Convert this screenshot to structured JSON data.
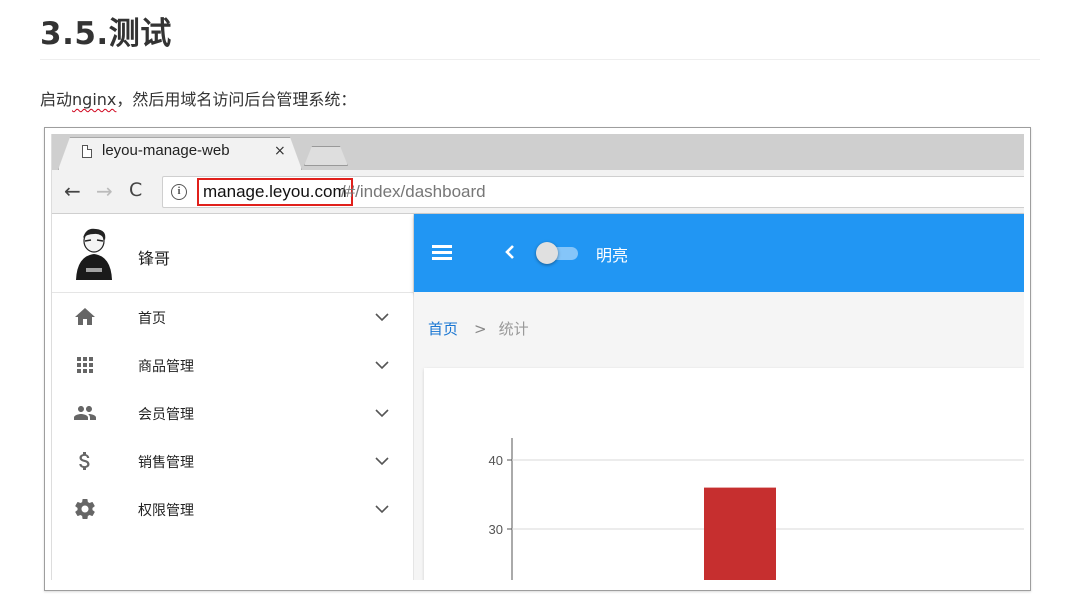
{
  "doc": {
    "heading": "3.5.测试",
    "para_before": "启动",
    "para_squiggle": "nginx",
    "para_after": "，然后用域名访问后台管理系统："
  },
  "browser": {
    "tab_title": "leyou-manage-web",
    "tab_close": "×",
    "back_glyph": "←",
    "forward_glyph": "→",
    "reload_glyph": "C",
    "info_glyph": "i",
    "url_host": "manage.leyou.com",
    "url_path": "/#/index/dashboard"
  },
  "sidebar": {
    "user_name": "锋哥",
    "items": [
      {
        "label": "首页",
        "icon": "home-icon"
      },
      {
        "label": "商品管理",
        "icon": "apps-grid-icon"
      },
      {
        "label": "会员管理",
        "icon": "people-icon"
      },
      {
        "label": "销售管理",
        "icon": "dollar-icon"
      },
      {
        "label": "权限管理",
        "icon": "gear-icon"
      }
    ]
  },
  "appbar": {
    "toggle_label": "明亮",
    "toggle_on": false,
    "color": "#2196f3"
  },
  "breadcrumb": {
    "home": "首页",
    "separator": ">",
    "current": "统计"
  },
  "chart_data": {
    "type": "bar",
    "y_ticks": [
      30,
      40
    ],
    "values": [
      36
    ],
    "bar_color": "#c62f2f",
    "grid": true
  },
  "colors": {
    "url_highlight": "#e0201b",
    "link_blue": "#1976d2"
  }
}
